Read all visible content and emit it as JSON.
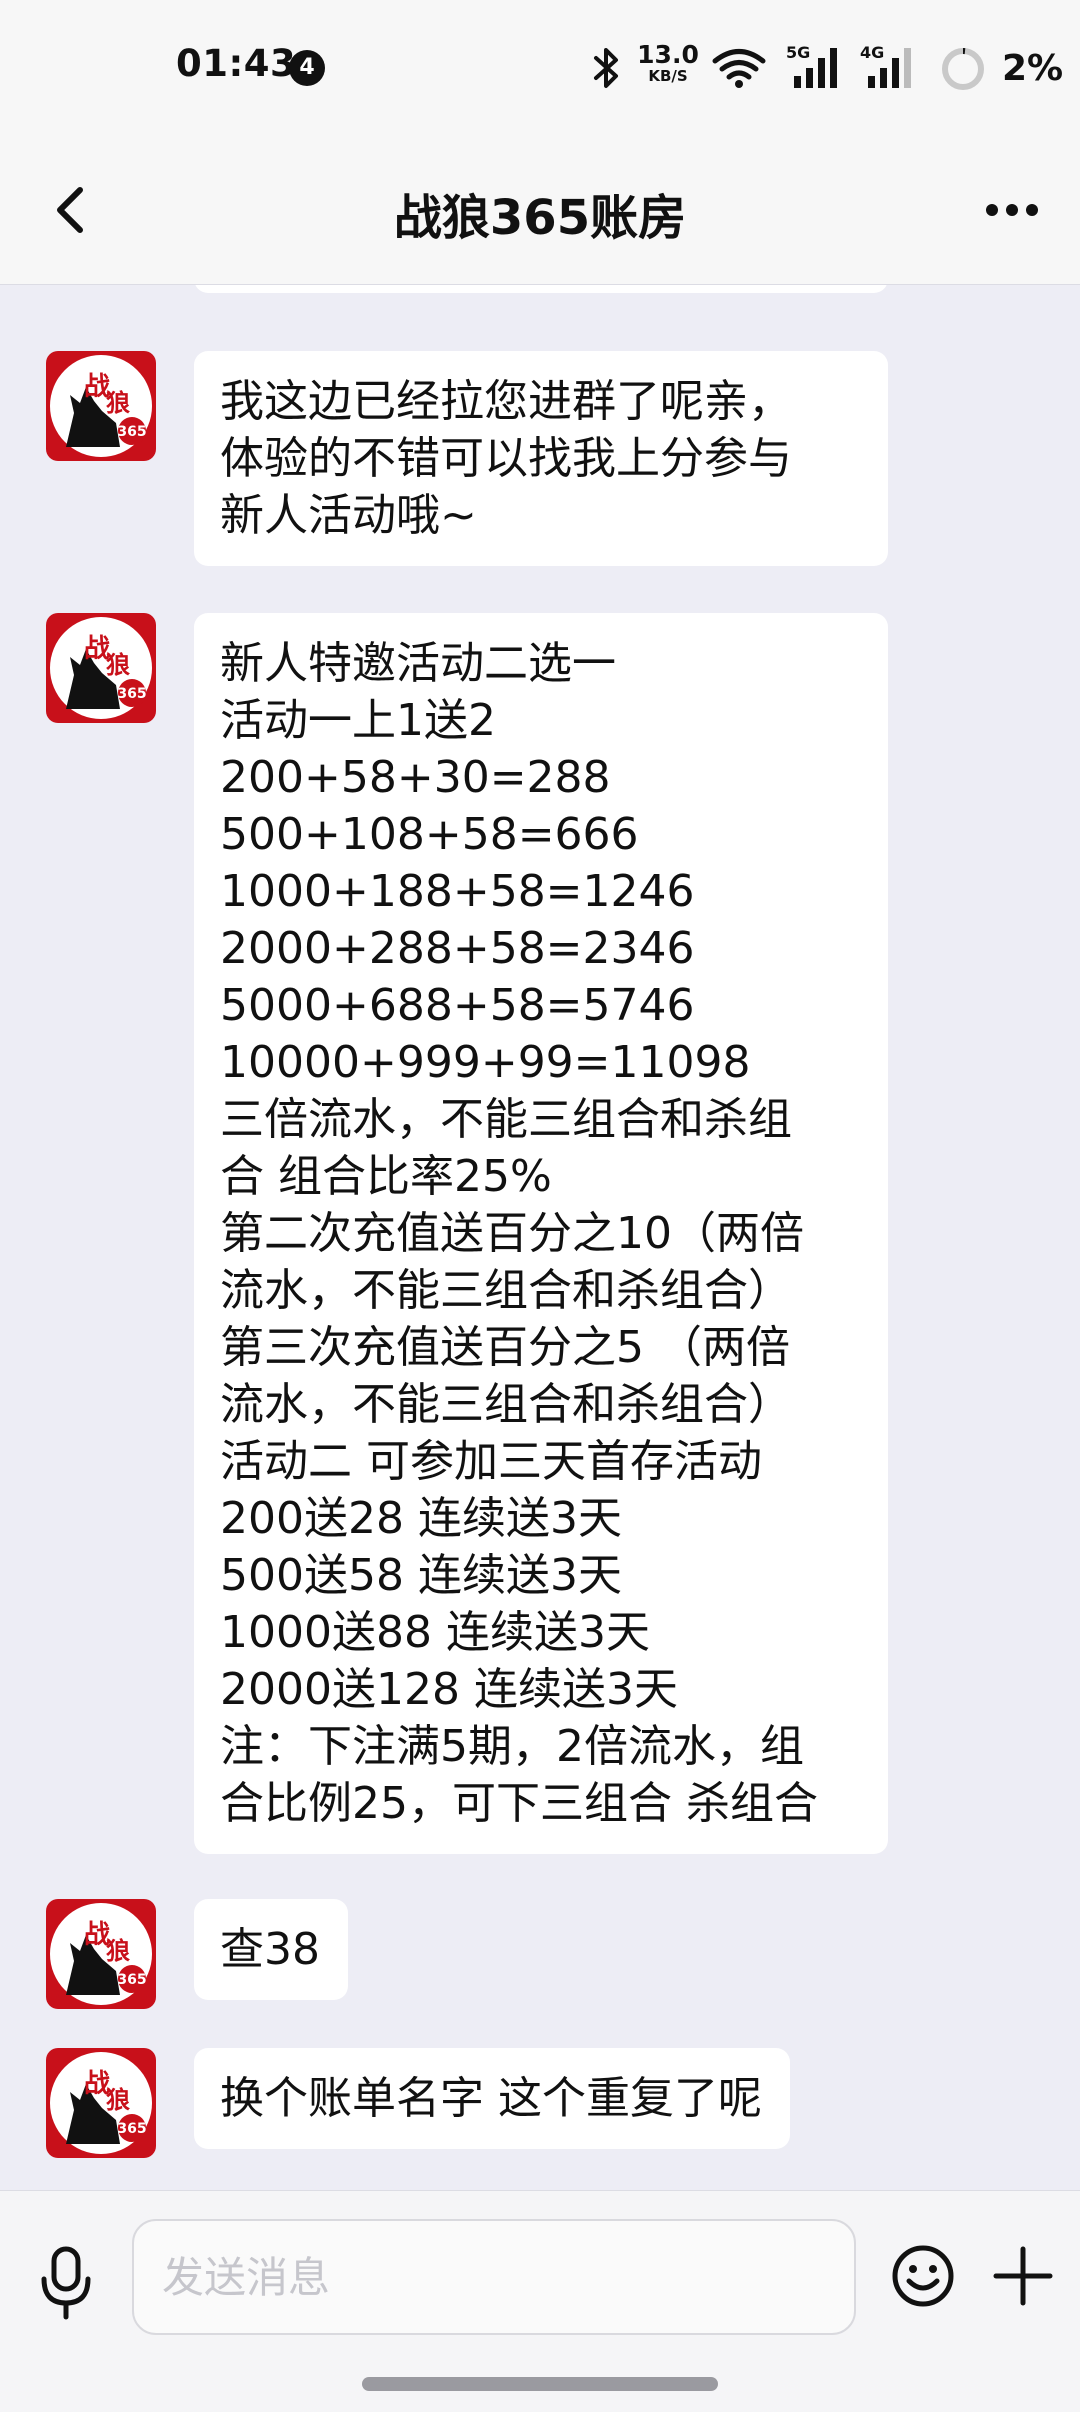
{
  "status_bar": {
    "time": "01:43",
    "notification_count": "4",
    "net_speed_value": "13.0",
    "net_speed_unit": "KB/S",
    "signal1_label": "5G",
    "signal2_label": "4G",
    "battery": "2%"
  },
  "header": {
    "title": "战狼365账房"
  },
  "avatar": {
    "logo_text_top": "战",
    "logo_text_mid": "狼",
    "logo_number": "365"
  },
  "messages": [
    {
      "text": "我这边已经拉您进群了呢亲，\n体验的不错可以找我上分参与\n新人活动哦~"
    },
    {
      "text": "新人特邀活动二选一\n活动一上1送2\n200+58+30=288\n500+108+58=666\n1000+188+58=1246\n2000+288+58=2346\n5000+688+58=5746\n10000+999+99=11098\n三倍流水，不能三组合和杀组\n合 组合比率25%\n第二次充值送百分之10（两倍\n流水，不能三组合和杀组合）\n第三次充值送百分之5 （两倍\n流水，不能三组合和杀组合）\n活动二 可参加三天首存活动\n200送28 连续送3天\n500送58 连续送3天\n1000送88 连续送3天\n2000送128 连续送3天\n注：下注满5期，2倍流水，组\n合比例25，可下三组合 杀组合"
    },
    {
      "text": "查38"
    },
    {
      "text": "换个账单名字 这个重复了呢"
    }
  ],
  "input": {
    "placeholder": "发送消息",
    "value": ""
  },
  "colors": {
    "chat_background": "#ededf5",
    "bubble": "#ffffff",
    "bar_background": "#f7f7f7",
    "logo_red": "#c8101a"
  }
}
